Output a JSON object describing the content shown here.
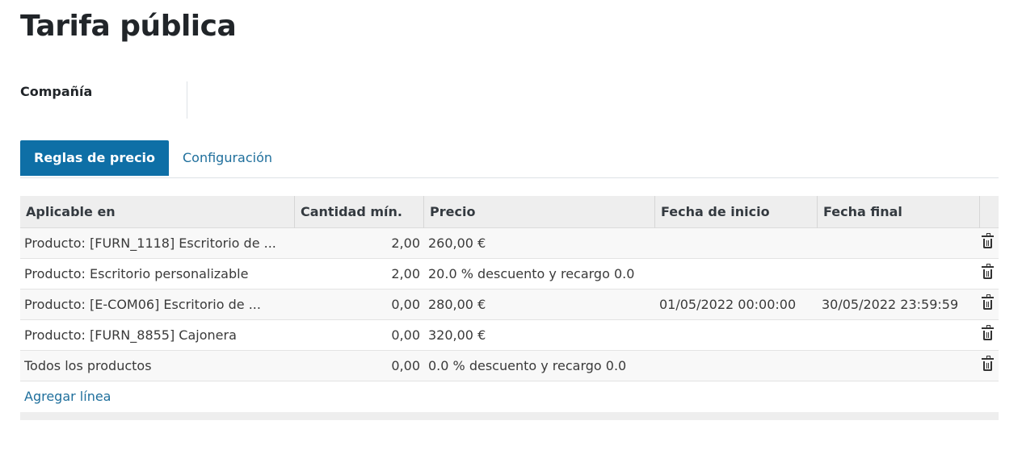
{
  "page": {
    "title": "Tarifa pública"
  },
  "fields": {
    "company_label": "Compañía",
    "company_value": ""
  },
  "tabs": [
    {
      "label": "Reglas de precio",
      "active": true
    },
    {
      "label": "Configuración",
      "active": false
    }
  ],
  "table": {
    "columns": [
      "Aplicable en",
      "Cantidad mín.",
      "Precio",
      "Fecha de inicio",
      "Fecha final"
    ],
    "rows": [
      {
        "applicable": "Producto: [FURN_1118] Escritorio de ...",
        "min_qty": "2,00",
        "price": "260,00 €",
        "start": "",
        "end": ""
      },
      {
        "applicable": "Producto: Escritorio personalizable",
        "min_qty": "2,00",
        "price": "20.0 % descuento y recargo 0.0",
        "start": "",
        "end": ""
      },
      {
        "applicable": "Producto: [E-COM06] Escritorio de ...",
        "min_qty": "0,00",
        "price": "280,00 €",
        "start": "01/05/2022 00:00:00",
        "end": "30/05/2022 23:59:59"
      },
      {
        "applicable": "Producto: [FURN_8855] Cajonera",
        "min_qty": "0,00",
        "price": "320,00 €",
        "start": "",
        "end": ""
      },
      {
        "applicable": "Todos los productos",
        "min_qty": "0,00",
        "price": "0.0 % descuento y recargo 0.0",
        "start": "",
        "end": ""
      }
    ],
    "add_line_label": "Agregar línea",
    "row_delete_icon": "trash-icon"
  },
  "colors": {
    "accent": "#0e6fa6",
    "link": "#1f6f9c",
    "header_bg": "#eeeeee"
  }
}
